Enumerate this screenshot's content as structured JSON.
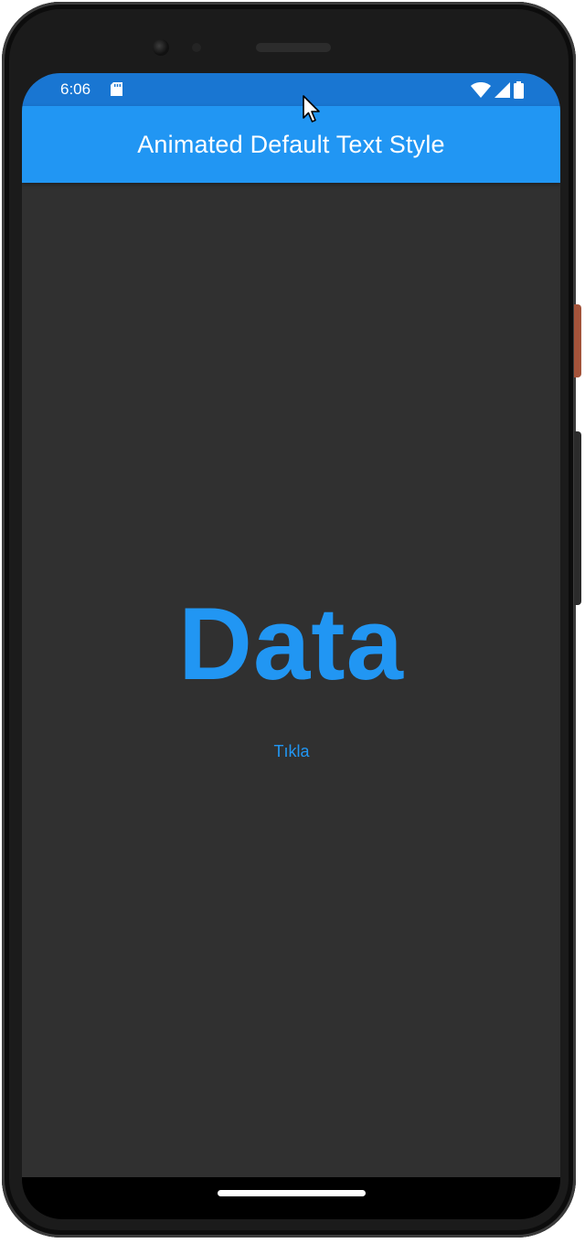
{
  "status_bar": {
    "time": "6:06",
    "icons": [
      "sd-card-icon",
      "wifi-icon",
      "cell-signal-icon",
      "battery-icon"
    ]
  },
  "app_bar": {
    "title": "Animated Default Text Style"
  },
  "main": {
    "animated_text": "Data",
    "button_label": "Tıkla"
  },
  "colors": {
    "accent": "#2196f3",
    "status_bar": "#1976d2",
    "background": "#303030",
    "text_on_accent": "#ffffff"
  }
}
